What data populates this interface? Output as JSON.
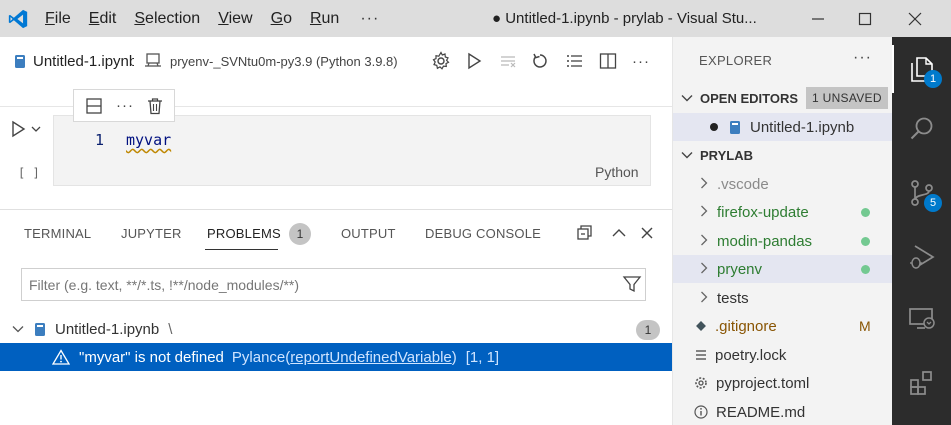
{
  "menubar": {
    "items": [
      {
        "first": "F",
        "rest": "ile"
      },
      {
        "first": "E",
        "rest": "dit"
      },
      {
        "first": "S",
        "rest": "election"
      },
      {
        "first": "V",
        "rest": "iew"
      },
      {
        "first": "G",
        "rest": "o"
      },
      {
        "first": "R",
        "rest": "un"
      }
    ],
    "more": "···"
  },
  "window": {
    "title": "● Untitled-1.ipynb - prylab - Visual Stu..."
  },
  "editor": {
    "tab_label": "Untitled-1.ipynb",
    "kernel_label": "pryenv-_SVNtu0m-py3.9 (Python 3.9.8)",
    "toolbar_more": "···",
    "cell": {
      "line_number": "1",
      "code": "myvar",
      "language": "Python",
      "execution_count": "[ ]",
      "more": "···"
    }
  },
  "panel": {
    "tabs": [
      "TERMINAL",
      "JUPYTER",
      "PROBLEMS",
      "OUTPUT",
      "DEBUG CONSOLE"
    ],
    "problems_count": "1",
    "filter_placeholder": "Filter (e.g. text, **/*.ts, !**/node_modules/**)",
    "file": {
      "name": "Untitled-1.ipynb",
      "path_sep": "\\",
      "count": "1"
    },
    "problem": {
      "message": "\"myvar\" is not defined",
      "source": "Pylance(",
      "code_link": "reportUndefinedVariable",
      "source_close": ")",
      "position": "[1, 1]"
    }
  },
  "explorer": {
    "title": "EXPLORER",
    "more": "···",
    "open_editors": {
      "label": "OPEN EDITORS",
      "badge": "1 UNSAVED",
      "items": [
        {
          "label": "Untitled-1.ipynb"
        }
      ]
    },
    "workspace": {
      "label": "PRYLAB",
      "items": [
        {
          "label": ".vscode",
          "color": "#8a8a8a"
        },
        {
          "label": "firefox-update",
          "color": "#2e7d32"
        },
        {
          "label": "modin-pandas",
          "color": "#2e7d32"
        },
        {
          "label": "pryenv",
          "color": "#2e7d32"
        },
        {
          "label": "tests",
          "color": "#333333"
        },
        {
          "label": ".gitignore",
          "color": "#895503",
          "decoration": "M"
        },
        {
          "label": "poetry.lock",
          "color": "#333333"
        },
        {
          "label": "pyproject.toml",
          "color": "#333333"
        },
        {
          "label": "README.md",
          "color": "#333333"
        }
      ]
    }
  },
  "activity_bar": {
    "explorer_badge": "1",
    "scm_badge": "5"
  },
  "colors": {
    "accent": "#0060c0",
    "badge": "#007acc",
    "git_added": "#73c991"
  }
}
